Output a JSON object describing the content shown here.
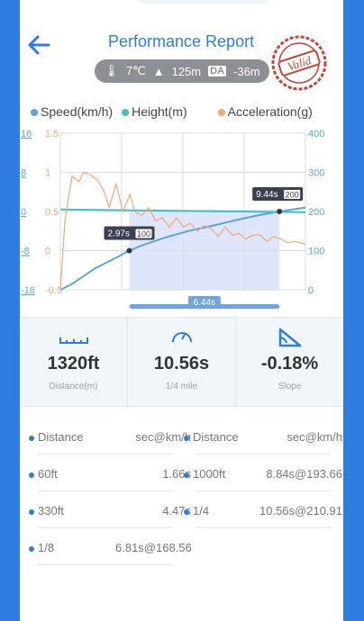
{
  "header": {
    "title": "Performance Report",
    "stamp_text": "Valid",
    "weather": {
      "temp": "7℃",
      "altitude": "125m",
      "da_label": "DA",
      "da_value": "-36m"
    }
  },
  "legend": {
    "speed": "Speed(km/h)",
    "height": "Height(m)",
    "acceleration": "Acceleration(g)"
  },
  "colors": {
    "speed": "#5aa6dc",
    "height": "#3ec1c1",
    "acceleration": "#f3a875",
    "accent": "#2f7de1",
    "band": "#c9d3f6"
  },
  "chart_data": {
    "type": "line",
    "axes": {
      "speed_ticks": [
        "16",
        "8",
        "0",
        "-8",
        "-16"
      ],
      "acceleration_ticks": [
        "1.5",
        "1",
        "0.5",
        "0",
        "-0.5"
      ],
      "height_ticks": [
        "400",
        "300",
        "200",
        "100",
        "0"
      ]
    },
    "x_range": [
      0,
      10.56
    ],
    "series": [
      {
        "name": "Speed(km/h)",
        "axis": "height",
        "x": [
          0.0,
          0.5,
          1.0,
          1.5,
          2.0,
          2.5,
          2.97,
          3.5,
          4.5,
          5.5,
          6.5,
          7.5,
          8.5,
          9.44,
          10.56
        ],
        "y": [
          0,
          15,
          35,
          55,
          70,
          85,
          100,
          113,
          133,
          150,
          163,
          177,
          190,
          200,
          210
        ]
      },
      {
        "name": "Height(m)",
        "axis": "height",
        "x": [
          0,
          10.56
        ],
        "y": [
          205,
          198
        ]
      },
      {
        "name": "Acceleration(g)",
        "axis": "acceleration",
        "x": [
          0.0,
          0.2,
          0.5,
          0.8,
          1.0,
          1.3,
          1.6,
          1.9,
          2.1,
          2.4,
          2.7,
          3.0,
          3.2,
          3.5,
          3.8,
          4.1,
          4.4,
          4.7,
          5.0,
          5.3,
          5.6,
          5.9,
          6.2,
          6.5,
          6.8,
          7.1,
          7.4,
          7.7,
          8.0,
          8.3,
          8.6,
          8.9,
          9.2,
          9.5,
          9.8,
          10.1,
          10.56
        ],
        "y": [
          -0.5,
          0.4,
          0.95,
          0.88,
          1.0,
          0.97,
          0.9,
          0.75,
          0.55,
          0.85,
          0.5,
          0.72,
          0.5,
          0.45,
          0.55,
          0.38,
          0.42,
          0.3,
          0.42,
          0.3,
          0.35,
          0.25,
          0.32,
          0.28,
          0.18,
          0.3,
          0.2,
          0.22,
          0.15,
          0.2,
          0.2,
          0.12,
          0.18,
          0.15,
          0.1,
          0.12,
          0.08
        ]
      }
    ],
    "markers": [
      {
        "time": "2.97s",
        "speed": "100",
        "x": 2.97,
        "y": 100
      },
      {
        "time": "9.44s",
        "speed": "200",
        "x": 9.44,
        "y": 200
      }
    ],
    "range": {
      "start": 2.97,
      "end": 9.44,
      "label": "6.44s"
    }
  },
  "stats": [
    {
      "value": "1320ft",
      "label": "Distance(m)",
      "icon": "ruler-icon"
    },
    {
      "value": "10.56s",
      "label": "1/4 mile",
      "icon": "speedometer-icon"
    },
    {
      "value": "-0.18%",
      "label": "Slope",
      "icon": "slope-icon"
    }
  ],
  "table": {
    "header": [
      "Distance",
      "sec@km/h",
      "Distance",
      "sec@km/h"
    ],
    "rows": [
      [
        "60ft",
        "1.66s",
        "1000ft",
        "8.84s@193.66"
      ],
      [
        "330ft",
        "4.47s",
        "1/4",
        "10.56s@210.91"
      ],
      [
        "1/8",
        "6.81s@168.56",
        "",
        ""
      ]
    ]
  }
}
